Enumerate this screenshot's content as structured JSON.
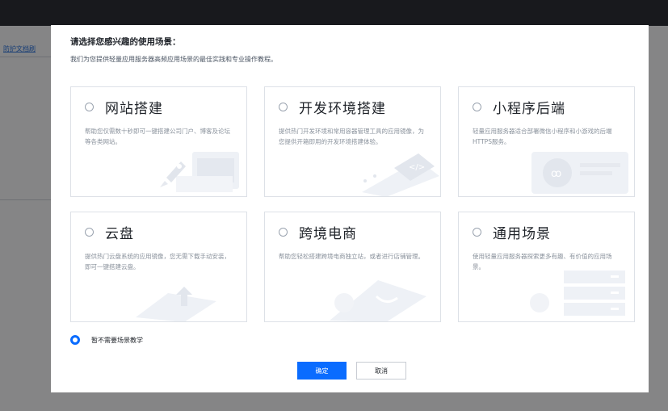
{
  "background": {
    "link_text": "防护文档刷"
  },
  "dialog": {
    "title": "请选择您感兴趣的使用场景：",
    "subtitle": "我们为您提供轻量应用服务器高频应用场景的最佳实践和专业操作教程。",
    "cards": [
      {
        "title": "网站搭建",
        "desc": "帮助您仅需数十秒即可一键搭建公司门户、博客及论坛等各类网站。",
        "icon": "rocket-browser-icon"
      },
      {
        "title": "开发环境搭建",
        "desc": "提供热门开发环境和常用容器管理工具的应用镜像，为您提供开箱即用的开发环境搭建体验。",
        "icon": "code-window-icon"
      },
      {
        "title": "小程序后端",
        "desc": "轻量应用服务器适合部署微信小程序和小游戏的后端HTTPS服务。",
        "icon": "miniprogram-icon"
      },
      {
        "title": "云盘",
        "desc": "提供热门云盘系统的应用镜像，您无需下载手动安装，即可一键搭建云盘。",
        "icon": "cloud-upload-icon"
      },
      {
        "title": "跨境电商",
        "desc": "帮助您轻松搭建跨境电商独立站，或者进行店铺管理。",
        "icon": "shopping-bag-icon"
      },
      {
        "title": "通用场景",
        "desc": "使用轻量应用服务器探索更多有趣、有价值的应用场景。",
        "icon": "server-stack-icon"
      }
    ],
    "none_option": {
      "label": "暂不需要场景教学",
      "selected": true
    },
    "ok_label": "确定",
    "cancel_label": "取消"
  },
  "colors": {
    "accent": "#0a6cff",
    "overlay": "#000000"
  }
}
